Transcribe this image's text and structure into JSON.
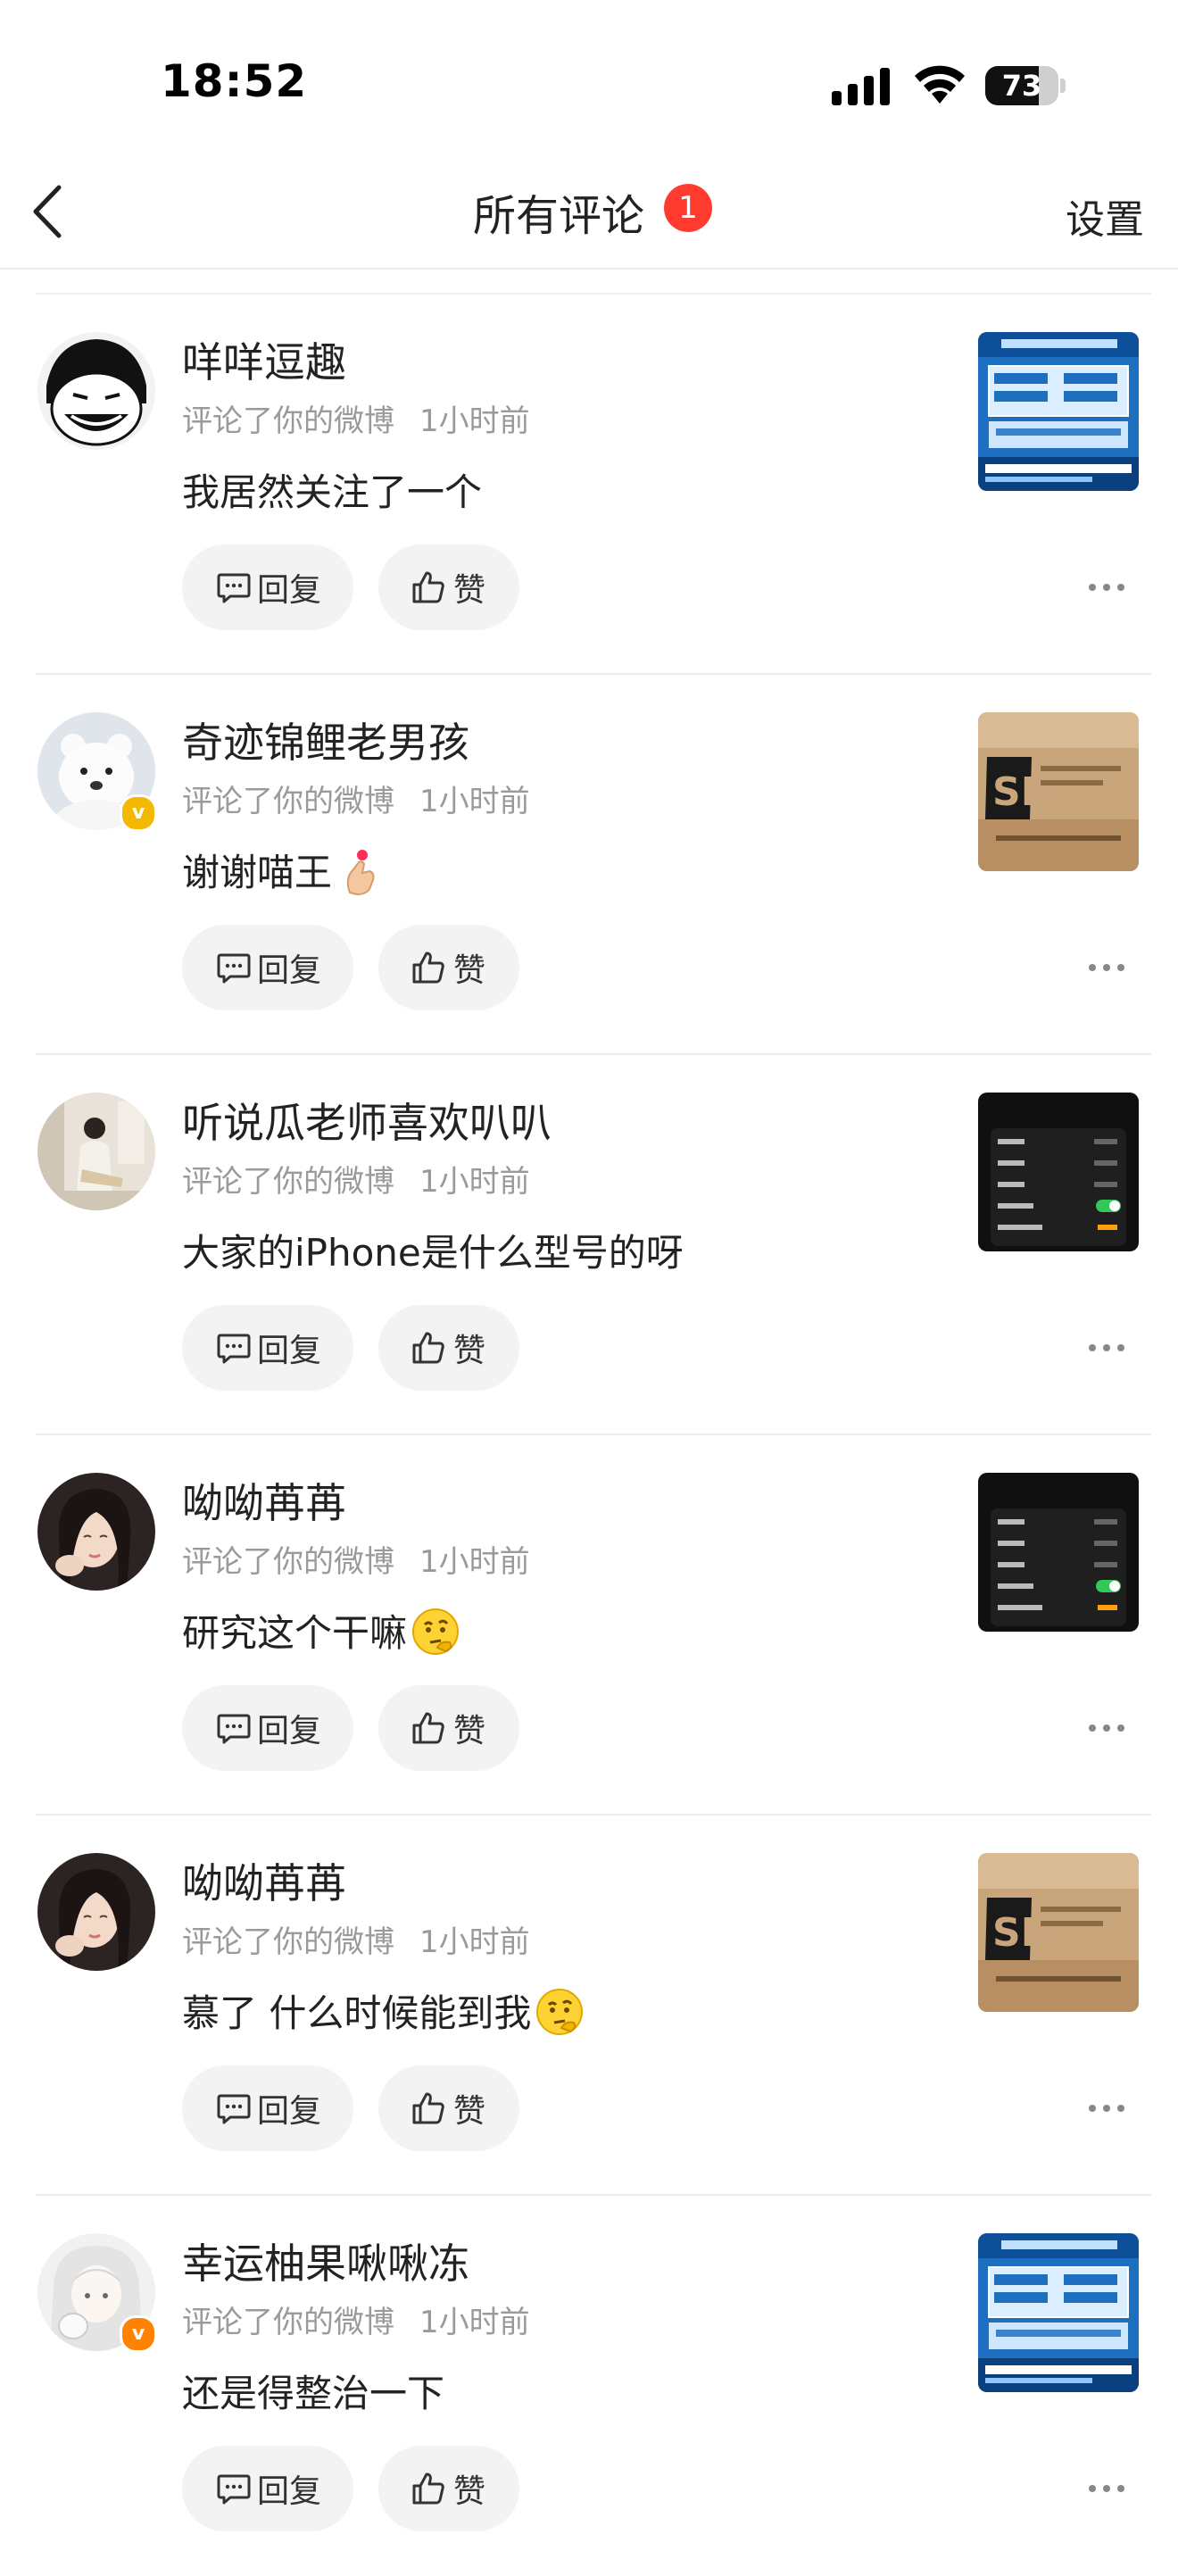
{
  "status": {
    "time": "18:52",
    "battery": "73",
    "battery_level": 0.73
  },
  "nav": {
    "title": "所有评论",
    "badge": "1",
    "settings": "设置"
  },
  "actions": {
    "reply": "回复",
    "like": "赞"
  },
  "comments": [
    {
      "name": "咩咩逗趣",
      "action": "评论了你的微博",
      "time": "1小时前",
      "content": "我居然关注了一个",
      "emoji": "",
      "thumb": "news",
      "avatar": "cartoon",
      "verified": ""
    },
    {
      "name": "奇迹锦鲤老男孩",
      "action": "评论了你的微博",
      "time": "1小时前",
      "content": "谢谢喵王",
      "emoji": "finger-heart",
      "thumb": "box",
      "avatar": "bear",
      "verified": "gold"
    },
    {
      "name": "听说瓜老师喜欢叭叭",
      "action": "评论了你的微博",
      "time": "1小时前",
      "content": "大家的iPhone是什么型号的呀",
      "emoji": "",
      "thumb": "dark",
      "avatar": "photo-light",
      "verified": ""
    },
    {
      "name": "呦呦苒苒",
      "action": "评论了你的微博",
      "time": "1小时前",
      "content": "研究这个干嘛",
      "emoji": "thinking",
      "thumb": "dark",
      "avatar": "girl",
      "verified": ""
    },
    {
      "name": "呦呦苒苒",
      "action": "评论了你的微博",
      "time": "1小时前",
      "content": "慕了 什么时候能到我",
      "emoji": "thinking",
      "thumb": "box",
      "avatar": "girl",
      "verified": ""
    },
    {
      "name": "幸运柚果啾啾冻",
      "action": "评论了你的微博",
      "time": "1小时前",
      "content": "还是得整治一下",
      "emoji": "",
      "thumb": "news",
      "avatar": "anime",
      "verified": "orange"
    }
  ]
}
